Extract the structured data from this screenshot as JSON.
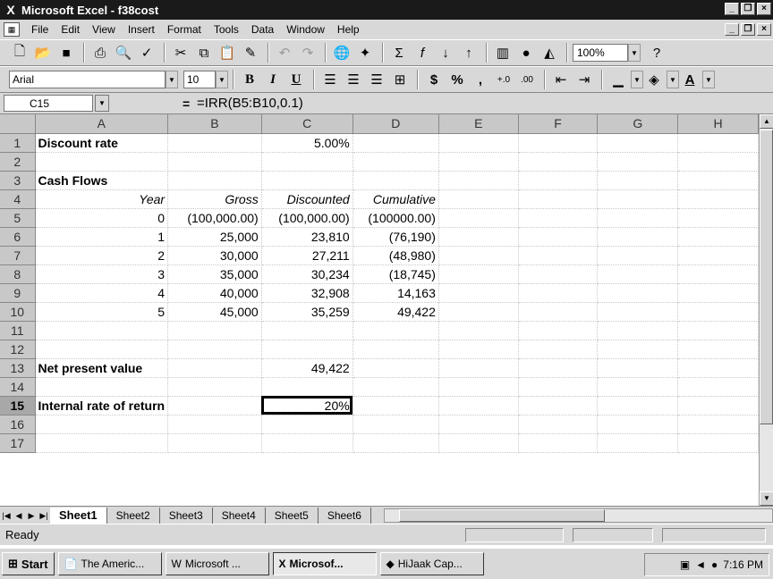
{
  "window": {
    "title": "Microsoft Excel - f38cost"
  },
  "menu": [
    "File",
    "Edit",
    "View",
    "Insert",
    "Format",
    "Tools",
    "Data",
    "Window",
    "Help"
  ],
  "toolbar_standard": {
    "icons": [
      "new-icon",
      "open-icon",
      "save-icon",
      "print-icon",
      "print-preview-icon",
      "spelling-icon",
      "cut-icon",
      "copy-icon",
      "paste-icon",
      "format-painter-icon",
      "undo-icon",
      "redo-icon",
      "hyperlink-icon",
      "web-toolbar-icon",
      "autosum-icon",
      "function-icon",
      "sort-ascending-icon",
      "sort-descending-icon",
      "chart-wizard-icon",
      "map-icon",
      "drawing-icon",
      "help-icon"
    ],
    "zoom": "100%"
  },
  "toolbar_formatting": {
    "font": "Arial",
    "size": "10",
    "buttons": {
      "bold": "B",
      "italic": "I",
      "underline": "U",
      "currency": "$",
      "percent": "%",
      "comma": ","
    }
  },
  "formula_bar": {
    "name_box": "C15",
    "equals": "=",
    "formula": "=IRR(B5:B10,0.1)"
  },
  "columns": [
    "A",
    "B",
    "C",
    "D",
    "E",
    "F",
    "G",
    "H"
  ],
  "rows": [
    {
      "num": "1",
      "cells": [
        "Discount rate",
        "",
        "5.00%",
        "",
        "",
        "",
        "",
        ""
      ]
    },
    {
      "num": "2",
      "cells": [
        "",
        "",
        "",
        "",
        "",
        "",
        "",
        ""
      ]
    },
    {
      "num": "3",
      "cells": [
        "Cash Flows",
        "",
        "",
        "",
        "",
        "",
        "",
        ""
      ]
    },
    {
      "num": "4",
      "cells": [
        "Year",
        "Gross",
        "Discounted",
        "Cumulative",
        "",
        "",
        "",
        ""
      ]
    },
    {
      "num": "5",
      "cells": [
        "0",
        "(100,000.00)",
        "(100,000.00)",
        "(100000.00)",
        "",
        "",
        "",
        ""
      ]
    },
    {
      "num": "6",
      "cells": [
        "1",
        "25,000",
        "23,810",
        "(76,190)",
        "",
        "",
        "",
        ""
      ]
    },
    {
      "num": "7",
      "cells": [
        "2",
        "30,000",
        "27,211",
        "(48,980)",
        "",
        "",
        "",
        ""
      ]
    },
    {
      "num": "8",
      "cells": [
        "3",
        "35,000",
        "30,234",
        "(18,745)",
        "",
        "",
        "",
        ""
      ]
    },
    {
      "num": "9",
      "cells": [
        "4",
        "40,000",
        "32,908",
        "14,163",
        "",
        "",
        "",
        ""
      ]
    },
    {
      "num": "10",
      "cells": [
        "5",
        "45,000",
        "35,259",
        "49,422",
        "",
        "",
        "",
        ""
      ]
    },
    {
      "num": "11",
      "cells": [
        "",
        "",
        "",
        "",
        "",
        "",
        "",
        ""
      ]
    },
    {
      "num": "12",
      "cells": [
        "",
        "",
        "",
        "",
        "",
        "",
        "",
        ""
      ]
    },
    {
      "num": "13",
      "cells": [
        "Net present value",
        "",
        "49,422",
        "",
        "",
        "",
        "",
        ""
      ]
    },
    {
      "num": "14",
      "cells": [
        "",
        "",
        "",
        "",
        "",
        "",
        "",
        ""
      ]
    },
    {
      "num": "15",
      "cells": [
        "Internal rate of return",
        "",
        "20%",
        "",
        "",
        "",
        "",
        ""
      ]
    },
    {
      "num": "16",
      "cells": [
        "",
        "",
        "",
        "",
        "",
        "",
        "",
        ""
      ]
    },
    {
      "num": "17",
      "cells": [
        "",
        "",
        "",
        "",
        "",
        "",
        "",
        ""
      ]
    }
  ],
  "sheet_tabs": [
    "Sheet1",
    "Sheet2",
    "Sheet3",
    "Sheet4",
    "Sheet5",
    "Sheet6"
  ],
  "active_sheet": "Sheet1",
  "status": {
    "text": "Ready"
  },
  "taskbar": {
    "start": "Start",
    "items": [
      "The Americ...",
      "Microsoft ...",
      "Microsof...",
      "HiJaak Cap..."
    ],
    "active_item": "Microsof...",
    "clock": "7:16 PM"
  }
}
